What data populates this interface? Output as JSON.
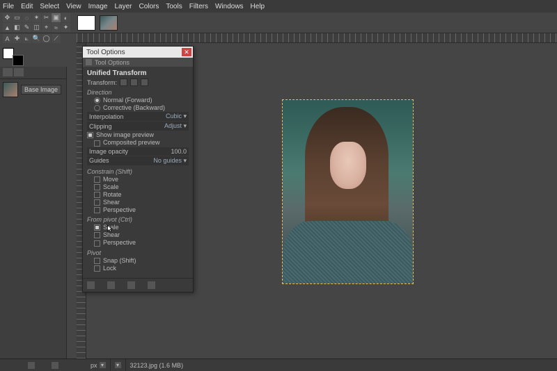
{
  "menu": [
    "File",
    "Edit",
    "Select",
    "View",
    "Image",
    "Layer",
    "Colors",
    "Tools",
    "Filters",
    "Windows",
    "Help"
  ],
  "layers": {
    "base_layer_name": "Base Image"
  },
  "dialog": {
    "title": "Tool Options",
    "subtab": "Tool Options",
    "heading": "Unified Transform",
    "transform_label": "Transform:",
    "direction": {
      "title": "Direction",
      "normal": "Normal (Forward)",
      "corrective": "Corrective (Backward)"
    },
    "interpolation": {
      "label": "Interpolation",
      "value": "Cubic"
    },
    "clipping": {
      "label": "Clipping",
      "value": "Adjust"
    },
    "show_preview": "Show image preview",
    "composited": "Composited preview",
    "opacity": {
      "label": "Image opacity",
      "value": "100.0"
    },
    "guides": {
      "label": "Guides",
      "value": "No guides"
    },
    "constrain": {
      "title": "Constrain (Shift)",
      "move": "Move",
      "scale": "Scale",
      "rotate": "Rotate",
      "shear": "Shear",
      "perspective": "Perspective"
    },
    "frompivot": {
      "title": "From pivot (Ctrl)",
      "scale": "Scale",
      "shear": "Shear",
      "perspective": "Perspective"
    },
    "pivot": {
      "title": "Pivot",
      "snap": "Snap (Shift)",
      "lock": "Lock"
    }
  },
  "status": {
    "filename": "32123.jpg (1.6 MB)",
    "px": "px"
  }
}
